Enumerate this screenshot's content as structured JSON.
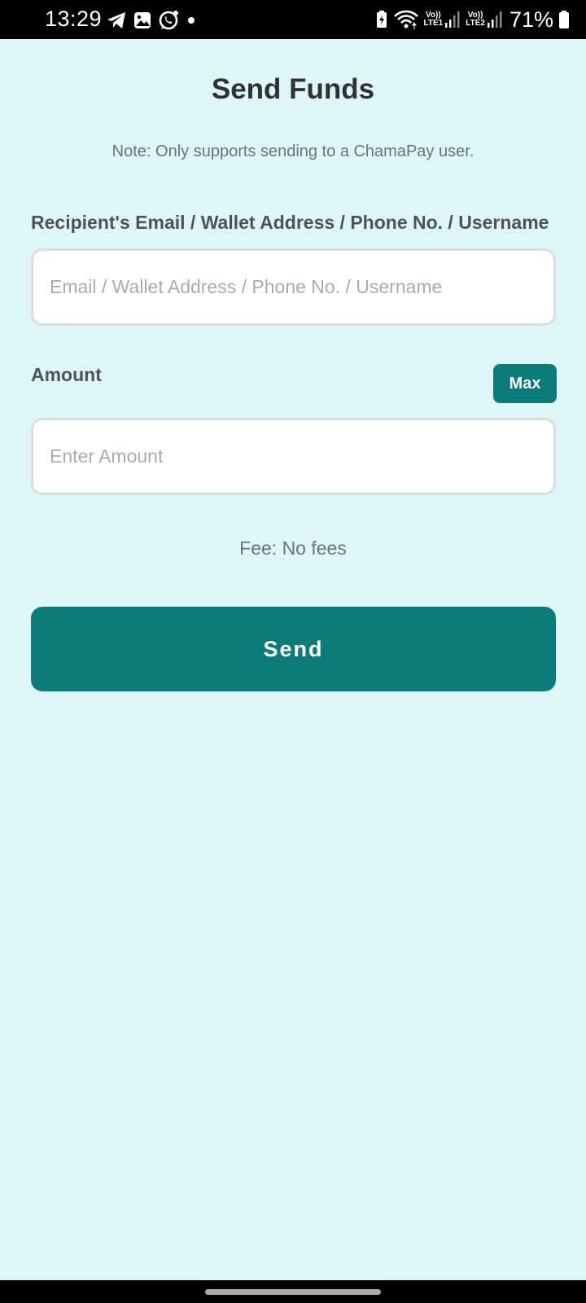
{
  "status_bar": {
    "time": "13:29",
    "left_icons": [
      "telegram-icon",
      "gallery-icon",
      "whatsapp-icon",
      "dot-icon"
    ],
    "right_icons": [
      "battery-saver-icon",
      "wifi-icon",
      "signal-sim1-icon",
      "signal-sim2-icon",
      "battery-icon"
    ],
    "sim1_label_top": "Vo))",
    "sim1_label_bottom": "LTE1",
    "sim2_label_top": "Vo))",
    "sim2_label_bottom": "LTE2",
    "battery_percent": "71%"
  },
  "page": {
    "title": "Send Funds",
    "note": "Note: Only supports sending to a ChamaPay user.",
    "recipient": {
      "label": "Recipient's Email / Wallet Address / Phone No. / Username",
      "placeholder": "Email / Wallet Address / Phone No. / Username",
      "value": ""
    },
    "amount": {
      "label": "Amount",
      "placeholder": "Enter Amount",
      "value": "",
      "max_label": "Max"
    },
    "fee_text": "Fee: No fees",
    "send_label": "Send"
  },
  "colors": {
    "background": "#dff6f8",
    "accent": "#0b7c7a",
    "title_text": "#2f3233",
    "muted_text": "#6a7478"
  }
}
